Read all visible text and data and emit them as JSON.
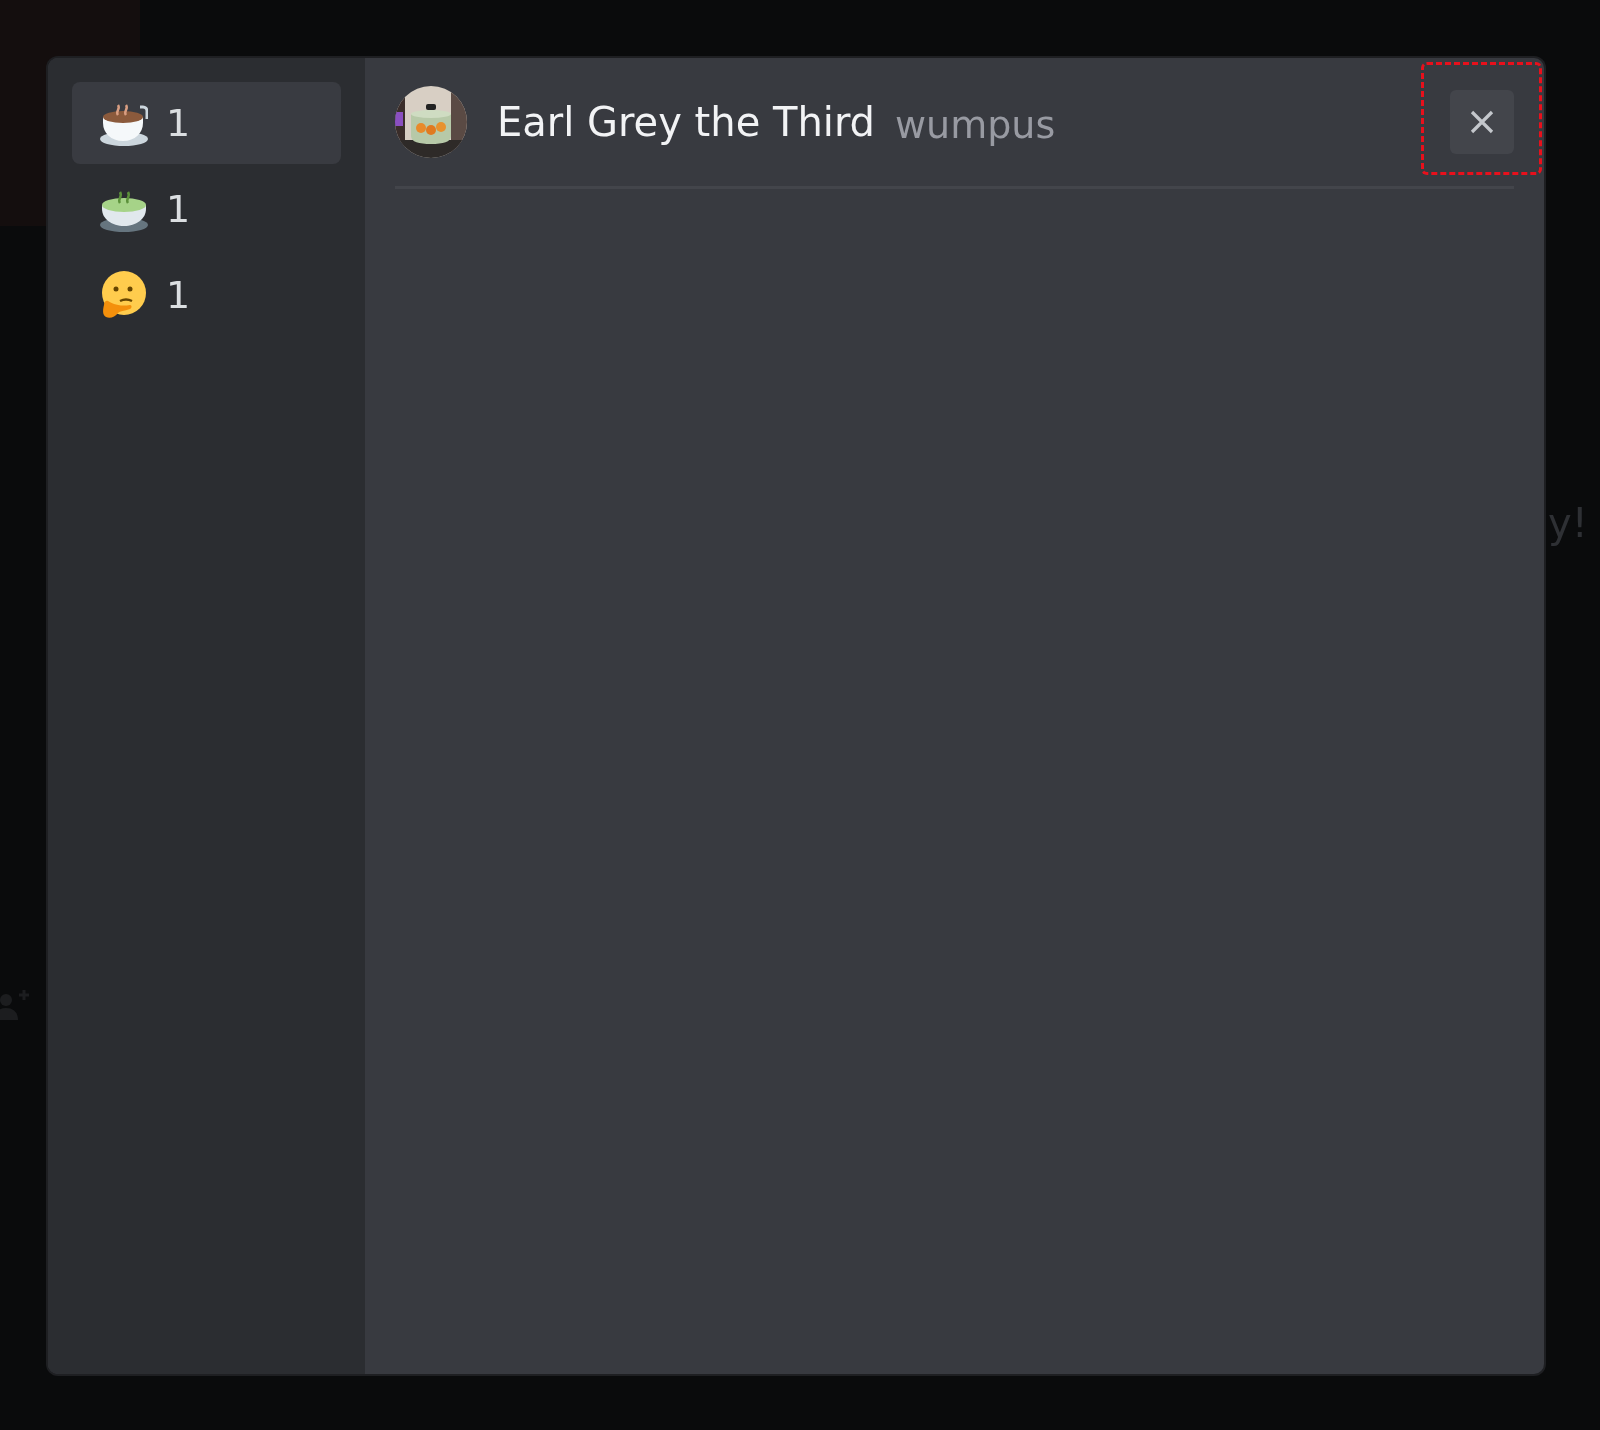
{
  "background": {
    "message_fragment": "y!"
  },
  "reactions": [
    {
      "kind": "coffee",
      "count": "1",
      "selected": true
    },
    {
      "kind": "tea",
      "count": "1",
      "selected": false
    },
    {
      "kind": "thinking",
      "count": "1",
      "selected": false
    }
  ],
  "reactor": {
    "display_name": "Earl Grey the Third",
    "username": "wumpus"
  },
  "close_button": {
    "highlighted": true
  }
}
